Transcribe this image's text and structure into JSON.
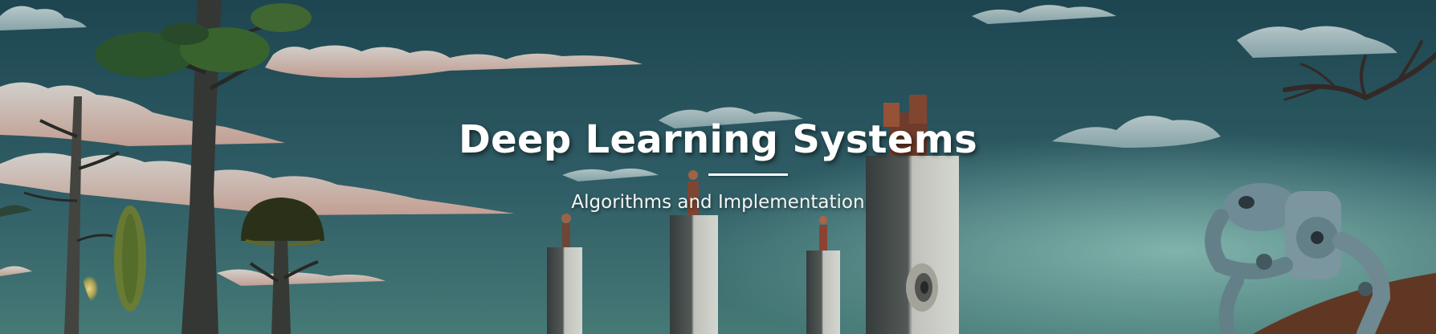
{
  "hero": {
    "title": "Deep Learning Systems",
    "subtitle": "Algorithms and Implementation",
    "background_art": "surreal-painting-trees-pillars-robot"
  },
  "colors": {
    "sky_top": "#1f4a55",
    "sky_mid": "#3a6c74",
    "sky_glow": "#8cc7be",
    "text": "#ffffff",
    "cloud": "#f3ede6",
    "cloud_pink": "#e7b9a7",
    "pillar": "#d9d7ce",
    "pillar_shadow": "#3b3f3e",
    "robot": "#7d9aa4"
  }
}
